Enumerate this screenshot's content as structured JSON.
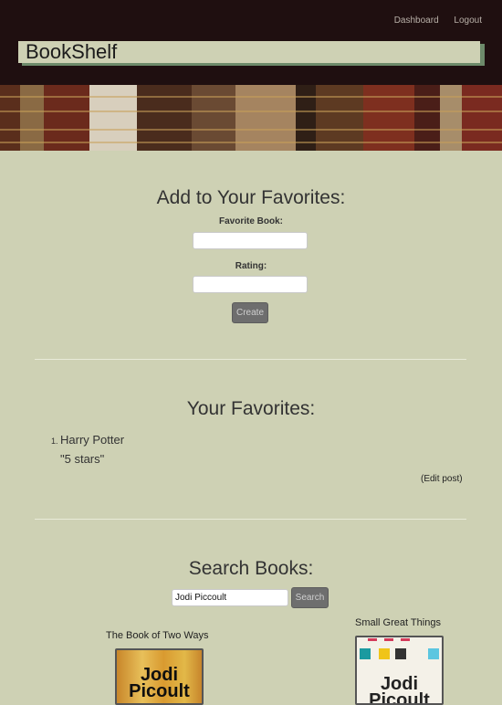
{
  "nav": {
    "dashboard": "Dashboard",
    "logout": "Logout"
  },
  "brand": "BookShelf",
  "add_form": {
    "title": "Add to Your Favorites:",
    "book_label": "Favorite Book:",
    "rating_label": "Rating:",
    "button": "Create"
  },
  "favorites": {
    "title": "Your Favorites:",
    "items": [
      {
        "number": "1.",
        "title": "Harry Potter",
        "rating": "\"5 stars\""
      }
    ],
    "edit_link": "(Edit post)"
  },
  "search": {
    "title": "Search Books:",
    "query": "Jodi Piccoult",
    "button": "Search",
    "results": [
      {
        "title": "The Book of Two Ways",
        "cover_author": "Jodi Picoult",
        "cover_tagline": "",
        "cover_color": "#d9a53a"
      },
      {
        "title": "Small Great Things",
        "cover_author": "Jodi Picoult",
        "cover_tagline": "",
        "cover_color": "#f4f1e8"
      }
    ]
  },
  "colors": {
    "page_bg": "#ced1b4",
    "header_bg": "#1f0f10",
    "logo_shadow": "#6d8a6a",
    "button_bg": "#6e6e6e"
  },
  "icons": {
    "banner": "bookshelf-banner-image"
  }
}
